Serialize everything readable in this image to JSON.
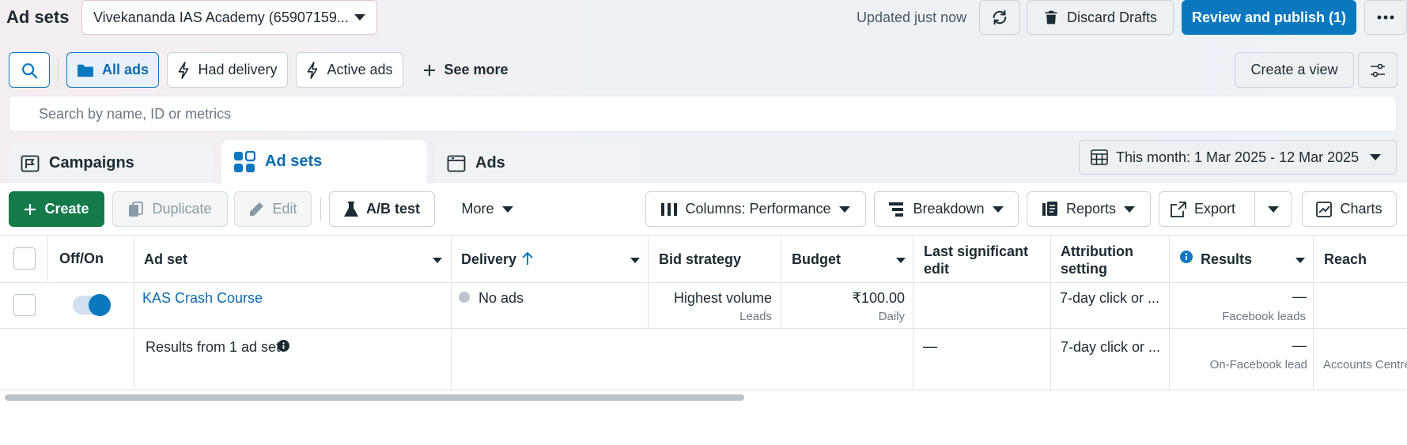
{
  "header": {
    "title": "Ad sets",
    "account": "Vivekananda IAS Academy (65907159...",
    "updated": "Updated just now",
    "discard_label": "Discard Drafts",
    "publish_label": "Review and publish (1)"
  },
  "filters": {
    "all_ads": "All ads",
    "had_delivery": "Had delivery",
    "active_ads": "Active ads",
    "see_more": "See more",
    "create_view": "Create a view"
  },
  "search": {
    "placeholder": "Search by name, ID or metrics"
  },
  "tabs": [
    {
      "label": "Campaigns"
    },
    {
      "label": "Ad sets"
    },
    {
      "label": "Ads"
    }
  ],
  "date_range": "This month: 1 Mar 2025 - 12 Mar 2025",
  "toolbar": {
    "create": "Create",
    "duplicate": "Duplicate",
    "edit": "Edit",
    "ab_test": "A/B test",
    "more": "More",
    "columns": "Columns: Performance",
    "breakdown": "Breakdown",
    "reports": "Reports",
    "export": "Export",
    "charts": "Charts"
  },
  "table": {
    "columns": {
      "off_on": "Off/On",
      "ad_set": "Ad set",
      "delivery": "Delivery",
      "bid_strategy": "Bid strategy",
      "budget": "Budget",
      "last_edit_1": "Last significant",
      "last_edit_2": "edit",
      "attribution_1": "Attribution",
      "attribution_2": "setting",
      "results": "Results",
      "reach": "Reach"
    },
    "row": {
      "name": "KAS Crash Course",
      "delivery": "No ads",
      "bid_strategy": "Highest volume",
      "bid_strategy_sub": "Leads",
      "budget": "₹100.00",
      "budget_sub": "Daily",
      "attribution": "7-day click or ...",
      "results": "—",
      "results_sub": "Facebook leads"
    },
    "summary": {
      "label": "Results from 1 ad set",
      "last_edit": "—",
      "attribution": "7-day click or ...",
      "results": "—",
      "results_sub": "On-Facebook lead",
      "reach_sub": "Accounts Centre"
    }
  },
  "colors": {
    "primary": "#0a78be",
    "create_green": "#137a4a",
    "text": "#1c2b33"
  }
}
